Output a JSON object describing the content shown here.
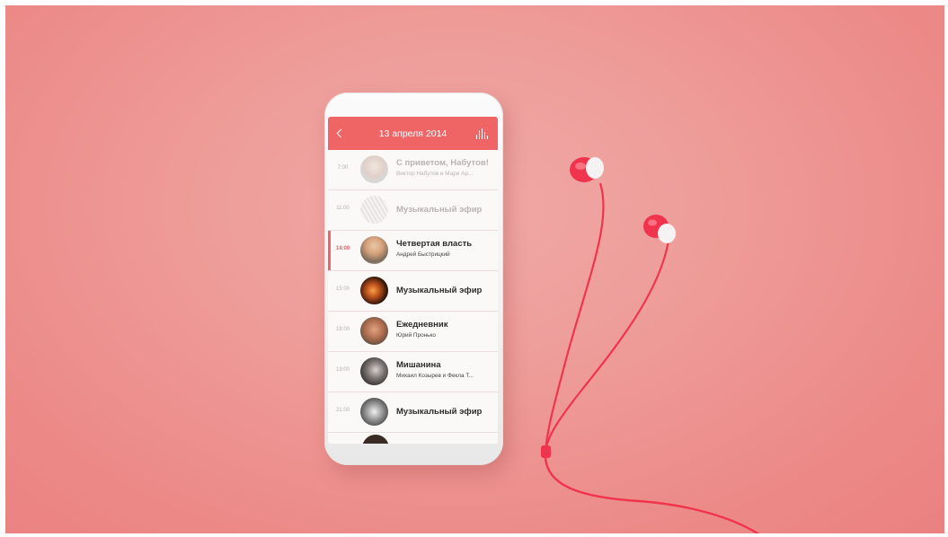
{
  "app": {
    "header_title": "13 апреля 2014",
    "back_icon": "chevron-left-icon",
    "live_icon": "equalizer-icon"
  },
  "schedule": [
    {
      "time": "7:00",
      "title": "С приветом, Набутов!",
      "subtitle": "Виктор Набутов и Мари Ар...",
      "state": "past",
      "avatar": "host-portrait"
    },
    {
      "time": "11:00",
      "title": "Музыкальный эфир",
      "subtitle": "",
      "state": "past",
      "avatar": "music-artwork"
    },
    {
      "time": "14:00",
      "title": "Четвертая власть",
      "subtitle": "Андрей Быстрицкий",
      "state": "current",
      "avatar": "host-portrait"
    },
    {
      "time": "15:00",
      "title": "Музыкальный эфир",
      "subtitle": "",
      "state": "upcoming",
      "avatar": "music-artwork"
    },
    {
      "time": "18:00",
      "title": "Ежедневник",
      "subtitle": "Юрий Пронько",
      "state": "upcoming",
      "avatar": "host-portrait"
    },
    {
      "time": "19:00",
      "title": "Мишанина",
      "subtitle": "Михаил Козырев и Фекла Т...",
      "state": "upcoming",
      "avatar": "host-portrait"
    },
    {
      "time": "21:00",
      "title": "Музыкальный эфир",
      "subtitle": "",
      "state": "upcoming",
      "avatar": "music-artwork"
    }
  ],
  "colors": {
    "accent": "#ef6566",
    "background": "#ec8f8d",
    "earphones": "#f0344d"
  }
}
